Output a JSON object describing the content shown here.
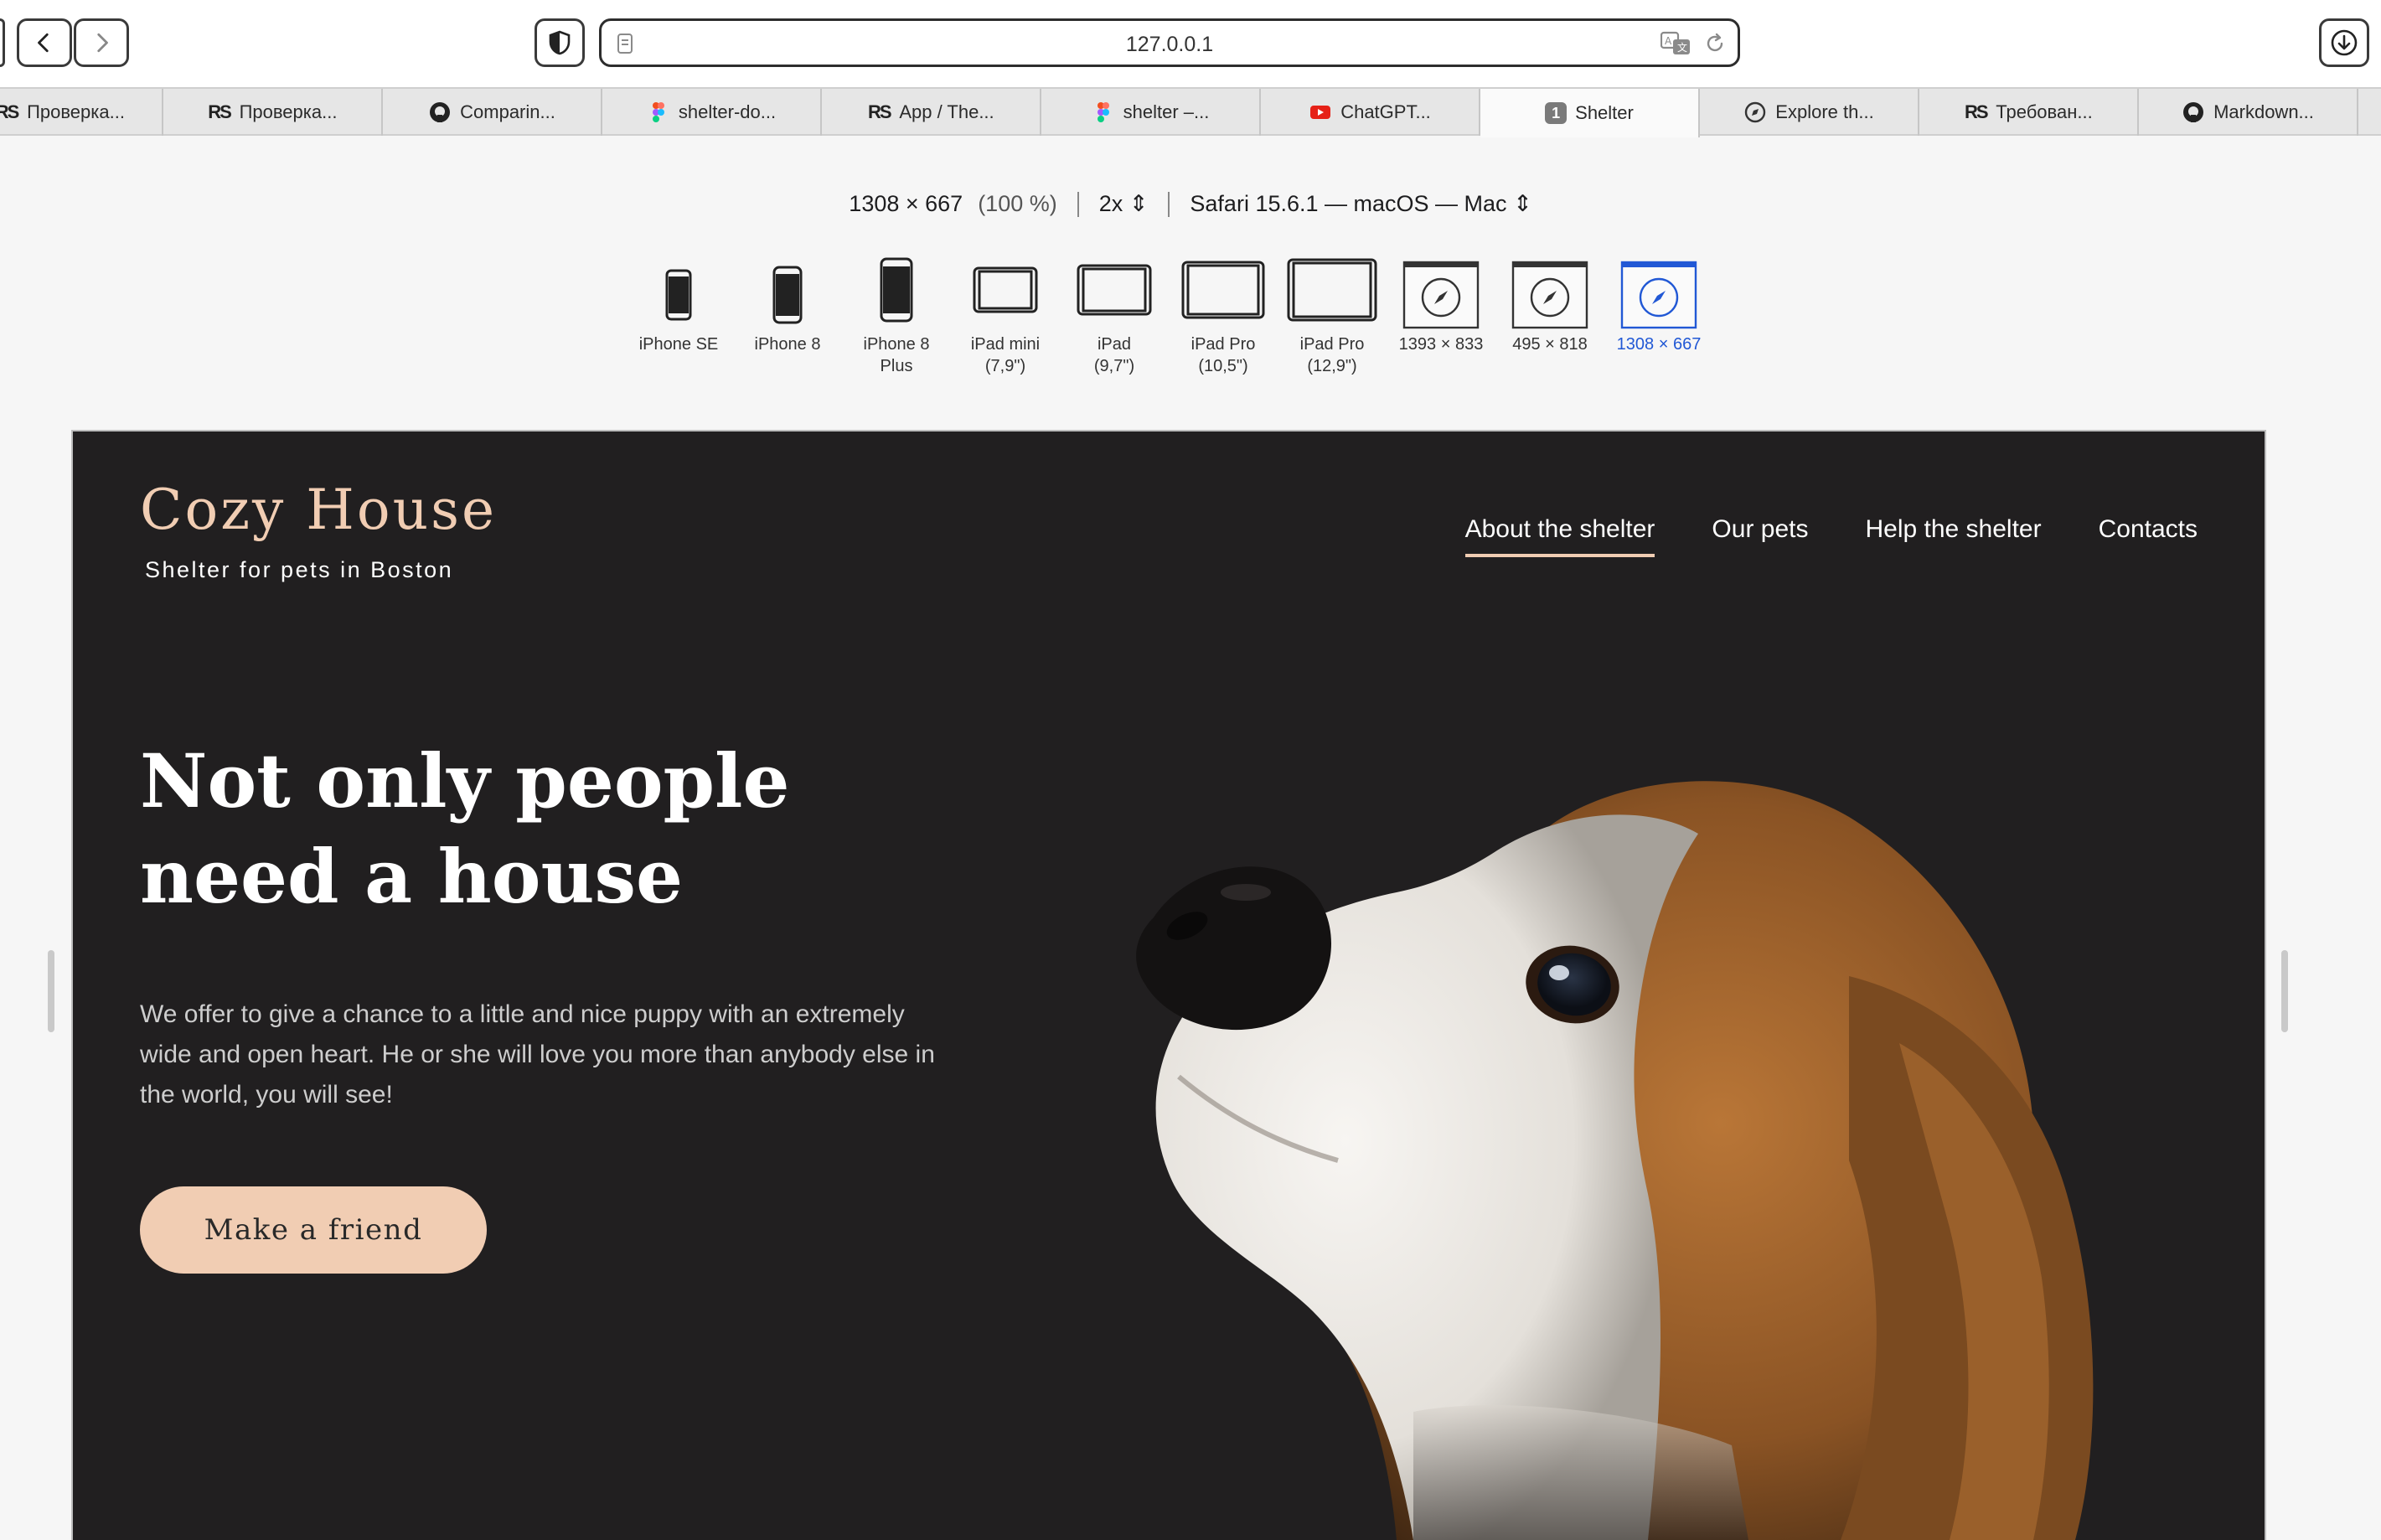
{
  "browser": {
    "url": "127.0.0.1"
  },
  "tabs": [
    {
      "label": "Проверка...",
      "icon": "rs-icon"
    },
    {
      "label": "Проверка...",
      "icon": "rs-icon"
    },
    {
      "label": "Comparin...",
      "icon": "github-icon"
    },
    {
      "label": "shelter-do...",
      "icon": "figma-icon"
    },
    {
      "label": "App / The...",
      "icon": "rs-icon"
    },
    {
      "label": "shelter –...",
      "icon": "figma-icon"
    },
    {
      "label": "ChatGPT...",
      "icon": "youtube-icon"
    },
    {
      "label": "Shelter",
      "icon": "badge-icon",
      "badge": "1",
      "active": true
    },
    {
      "label": "Explore th...",
      "icon": "compass-icon"
    },
    {
      "label": "Требован...",
      "icon": "rs-icon"
    },
    {
      "label": "Markdown...",
      "icon": "github-icon"
    }
  ],
  "responsive": {
    "size": "1308 × 667",
    "percent": "(100 %)",
    "scale": "2x",
    "agent": "Safari 15.6.1 — macOS — Mac",
    "devices": [
      {
        "label": "iPhone SE",
        "icon": "phone-icon"
      },
      {
        "label": "iPhone 8",
        "icon": "phone-icon"
      },
      {
        "label": "iPhone 8 Plus",
        "icon": "phone-icon"
      },
      {
        "label": "iPad mini (7,9\")",
        "icon": "tablet-icon"
      },
      {
        "label": "iPad (9,7\")",
        "icon": "tablet-icon"
      },
      {
        "label": "iPad Pro (10,5\")",
        "icon": "tablet-icon"
      },
      {
        "label": "iPad Pro (12,9\")",
        "icon": "tablet-icon"
      },
      {
        "label": "1393 × 833",
        "icon": "safari-window-icon"
      },
      {
        "label": "495 × 818",
        "icon": "safari-window-icon"
      },
      {
        "label": "1308 × 667",
        "icon": "safari-window-icon",
        "active": true
      }
    ]
  },
  "site": {
    "logo_title": "Cozy House",
    "logo_subtitle": "Shelter for pets in Boston",
    "nav": [
      "About the shelter",
      "Our pets",
      "Help the shelter",
      "Contacts"
    ],
    "hero_title_line1": "Not only people",
    "hero_title_line2": "need a house",
    "hero_text": "We offer to give a chance to a little and nice puppy with an extremely wide and open heart. He or she will love you more than anybody else in the world, you will see!",
    "cta_label": "Make a friend"
  },
  "colors": {
    "accent": "#f1cdb3",
    "site_bg": "#211f20",
    "active_device": "#2158d5"
  }
}
